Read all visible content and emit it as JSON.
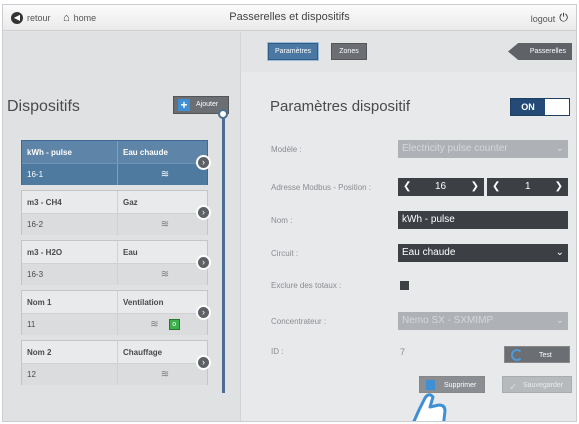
{
  "topbar": {
    "back_label": "retour",
    "home_label": "home",
    "title": "Passerelles et dispositifs",
    "logout_label": "logout"
  },
  "tabs": [
    {
      "label": "Paramètres",
      "active": true
    },
    {
      "label": "Zones",
      "active": false
    }
  ],
  "passerelles_label": "Passerelles",
  "devices": {
    "title": "Dispositifs",
    "add_label": "Ajouter",
    "items": [
      {
        "type": "kWh - pulse",
        "name": "Eau chaude",
        "address": "16-1",
        "selected": true,
        "status": false
      },
      {
        "type": "m3 - CH4",
        "name": "Gaz",
        "address": "16-2",
        "selected": false,
        "status": false
      },
      {
        "type": "m3 - H2O",
        "name": "Eau",
        "address": "16-3",
        "selected": false,
        "status": false
      },
      {
        "type": "Nom 1",
        "name": "Ventilation",
        "address": "11",
        "selected": false,
        "status": true
      },
      {
        "type": "Nom 2",
        "name": "Chauffage",
        "address": "12",
        "selected": false,
        "status": false
      }
    ]
  },
  "params": {
    "title": "Paramètres dispositif",
    "toggle_label": "ON",
    "model_label": "Modèle :",
    "model_value": "Electricity pulse counter",
    "modbus_label": "Adresse Modbus - Position :",
    "modbus_address": "16",
    "modbus_position": "1",
    "name_label": "Nom :",
    "name_value": "kWh - pulse",
    "circuit_label": "Circuit :",
    "circuit_value": "Eau chaude",
    "exclude_label": "Exclure des totaux :",
    "concentrator_label": "Concentrateur :",
    "concentrator_value": "Nemo SX - SXMIMP",
    "id_label": "ID :",
    "id_value": "7",
    "test_label": "Test",
    "delete_label": "Supprimer",
    "save_label": "Sauvegarder"
  }
}
